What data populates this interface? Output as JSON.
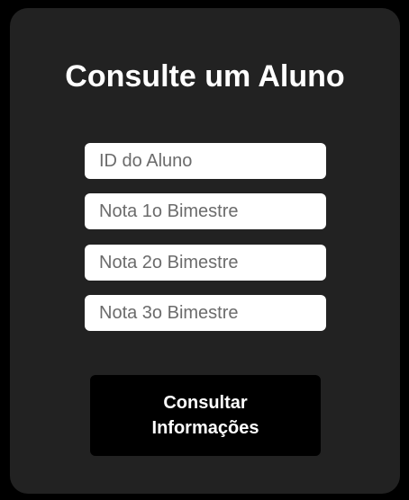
{
  "form": {
    "title": "Consulte um Aluno",
    "fields": [
      {
        "placeholder": "ID do Aluno",
        "value": ""
      },
      {
        "placeholder": "Nota 1o Bimestre",
        "value": ""
      },
      {
        "placeholder": "Nota 2o Bimestre",
        "value": ""
      },
      {
        "placeholder": "Nota 3o Bimestre",
        "value": ""
      }
    ],
    "submit_label": "Consultar Informações"
  },
  "colors": {
    "page_background": "#000000",
    "card_background": "#222222",
    "input_background": "#ffffff",
    "button_background": "#000000",
    "text": "#ffffff"
  }
}
